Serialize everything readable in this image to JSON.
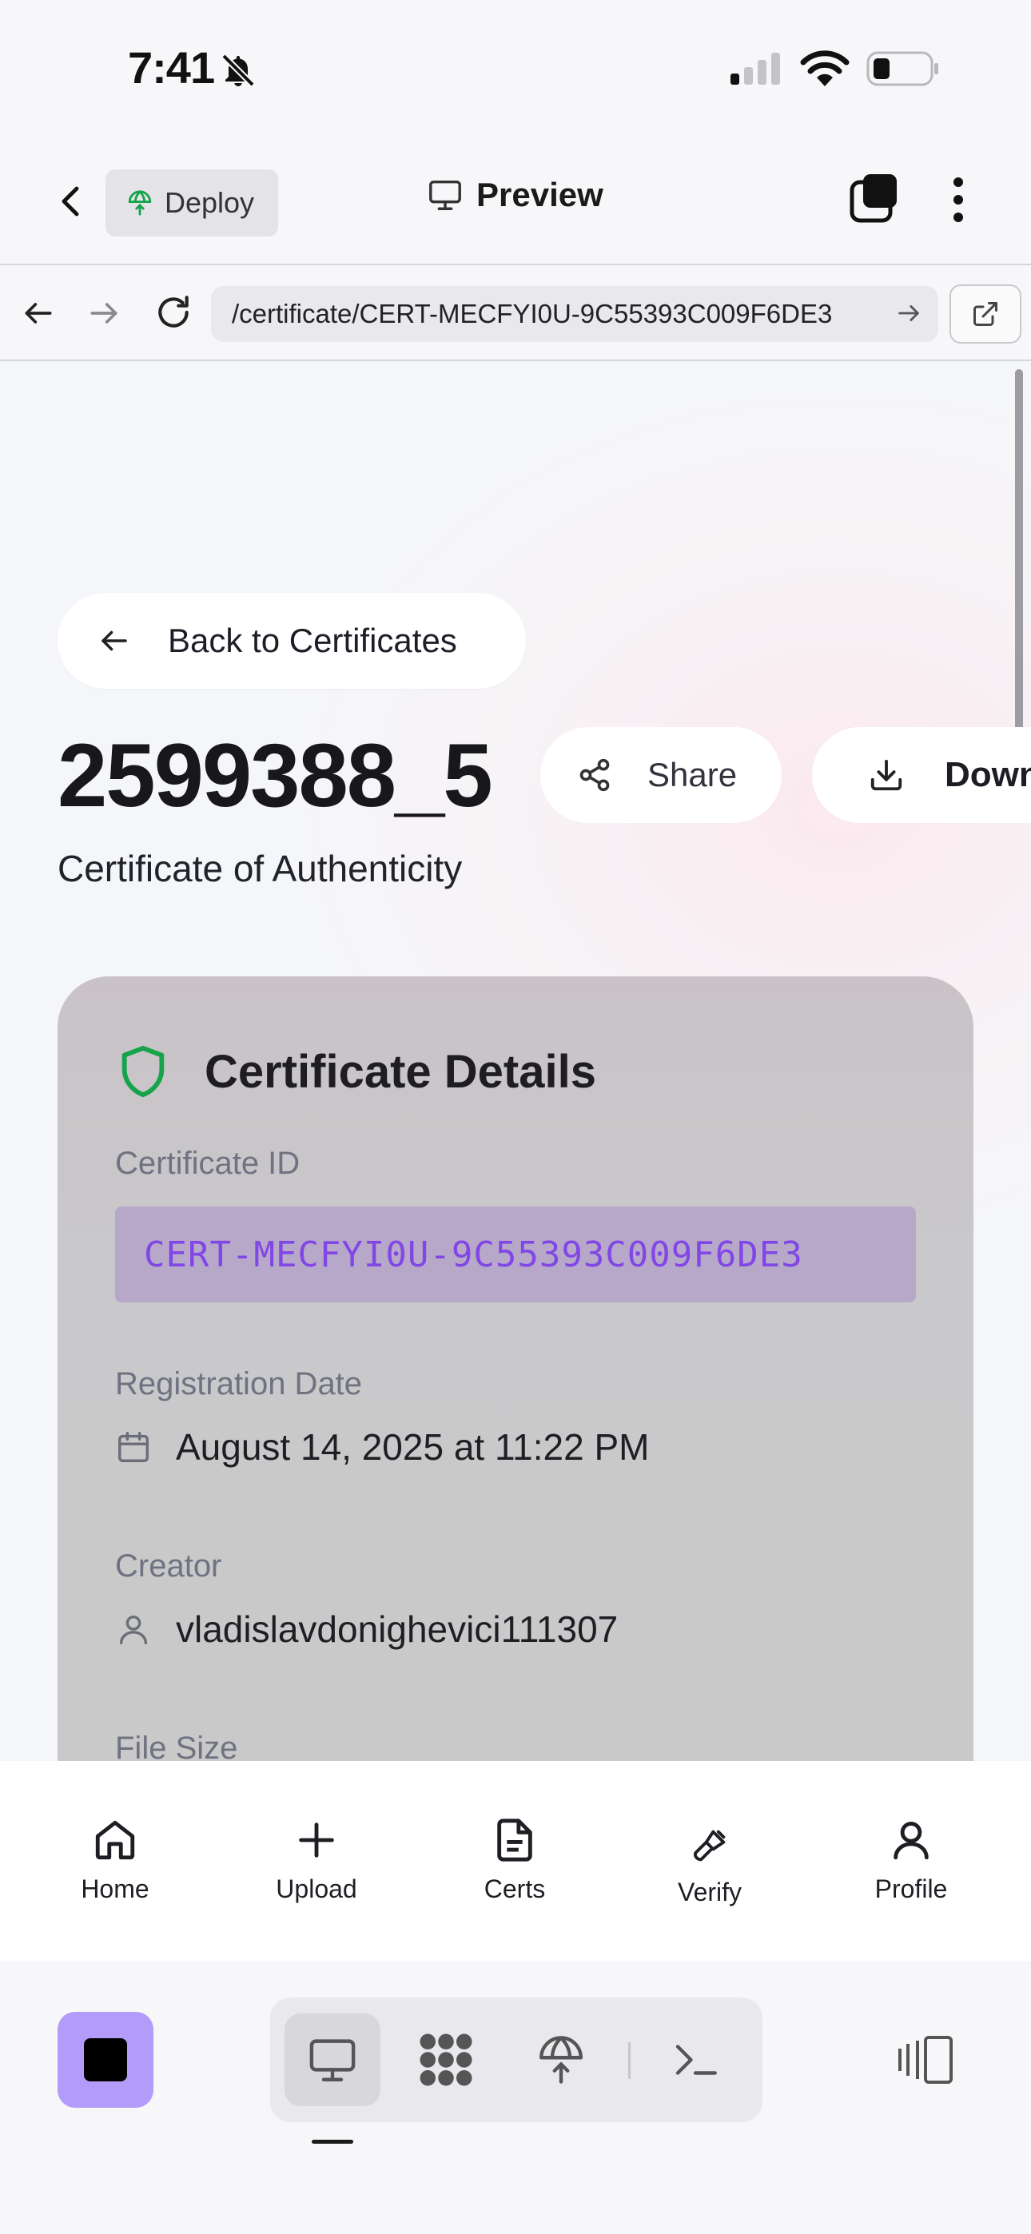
{
  "status_bar": {
    "time": "7:41",
    "bell_icon": "bell-slash-icon",
    "signal_icon": "cellular-signal-icon",
    "wifi_icon": "wifi-icon",
    "battery_icon": "battery-low-icon"
  },
  "toolbar": {
    "back_icon": "chevron-left-icon",
    "deploy_label": "Deploy",
    "deploy_icon": "globe-upload-icon",
    "preview_label": "Preview",
    "preview_icon": "monitor-icon",
    "tabs_icon": "tabs-icon",
    "more_icon": "more-vertical-icon"
  },
  "url_bar": {
    "url": "/certificate/CERT-MECFYI0U-9C55393C009F6DE3",
    "back_icon": "arrow-left-icon",
    "forward_icon": "arrow-right-icon",
    "reload_icon": "reload-icon",
    "open_icon": "external-link-icon"
  },
  "page": {
    "back_link": "Back to Certificates",
    "title": "2599388_5",
    "subtitle": "Certificate of Authenticity",
    "share_label": "Share",
    "download_label": "Down",
    "details": {
      "heading": "Certificate Details",
      "id_label": "Certificate ID",
      "id_value": "CERT-MECFYI0U-9C55393C009F6DE3",
      "date_label": "Registration Date",
      "date_value": "August 14, 2025 at 11:22 PM",
      "creator_label": "Creator",
      "creator_value": "vladislavdonighevici111307",
      "file_size_label": "File Size"
    }
  },
  "app_tabs": [
    {
      "label": "Home",
      "icon": "home-icon"
    },
    {
      "label": "Upload",
      "icon": "plus-icon"
    },
    {
      "label": "Certs",
      "icon": "document-icon"
    },
    {
      "label": "Verify",
      "icon": "brush-icon"
    },
    {
      "label": "Profile",
      "icon": "user-icon"
    }
  ],
  "host_bar": {
    "stop_icon": "stop-icon",
    "views": [
      "monitor-icon",
      "dots-grid-icon",
      "globe-icon",
      "terminal-icon"
    ],
    "panel_icon": "panel-toggle-icon"
  },
  "colors": {
    "accent_purple": "#8147e6",
    "shield_green": "#16a34a",
    "stop_button": "#b39cf9"
  }
}
